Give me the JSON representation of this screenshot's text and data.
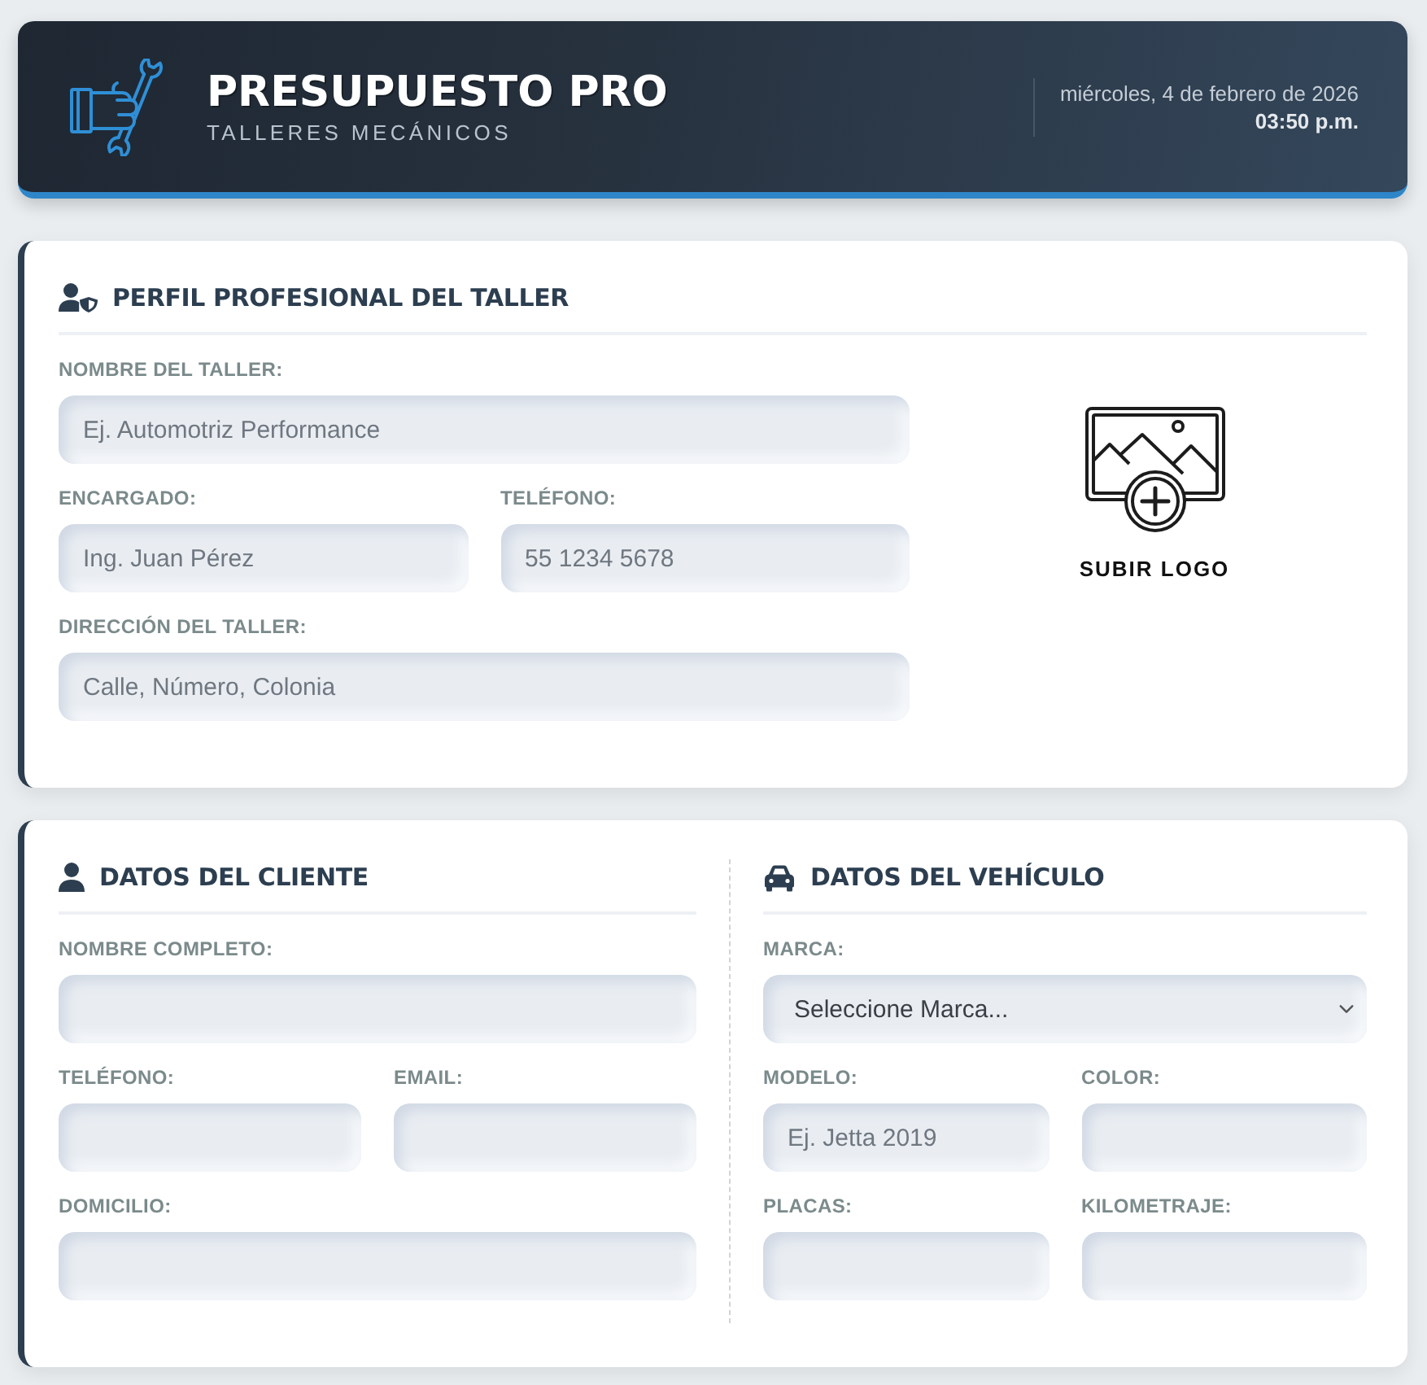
{
  "header": {
    "title": "PRESUPUESTO PRO",
    "subtitle": "TALLERES MECÁNICOS",
    "date": "miércoles, 4 de febrero de 2026",
    "time": "03:50 p.m."
  },
  "workshop_profile": {
    "title": "PERFIL PROFESIONAL DEL TALLER",
    "rows": [
      [
        {
          "label": "NOMBRE DEL TALLER:",
          "kind": "text",
          "placeholder": "Ej. Automotriz Performance"
        }
      ],
      [
        {
          "label": "ENCARGADO:",
          "kind": "text",
          "placeholder": "Ing. Juan Pérez"
        },
        {
          "label": "TELÉFONO:",
          "kind": "text",
          "placeholder": "55 1234 5678"
        }
      ],
      [
        {
          "label": "DIRECCIÓN DEL TALLER:",
          "kind": "text",
          "placeholder": "Calle, Número, Colonia"
        }
      ]
    ],
    "logo_upload": {
      "label": "SUBIR LOGO"
    }
  },
  "client": {
    "title": "DATOS DEL CLIENTE",
    "rows": [
      [
        {
          "label": "NOMBRE COMPLETO:",
          "kind": "text"
        }
      ],
      [
        {
          "label": "TELÉFONO:",
          "kind": "text"
        },
        {
          "label": "EMAIL:",
          "kind": "text"
        }
      ],
      [
        {
          "label": "DOMICILIO:",
          "kind": "text"
        }
      ]
    ]
  },
  "vehicle": {
    "title": "DATOS DEL VEHÍCULO",
    "rows": [
      [
        {
          "label": "MARCA:",
          "kind": "select",
          "value": "Seleccione Marca..."
        }
      ],
      [
        {
          "label": "MODELO:",
          "kind": "text",
          "placeholder": "Ej. Jetta 2019"
        },
        {
          "label": "COLOR:",
          "kind": "text"
        }
      ],
      [
        {
          "label": "PLACAS:",
          "kind": "text"
        },
        {
          "label": "KILOMETRAJE:",
          "kind": "text"
        }
      ]
    ]
  }
}
